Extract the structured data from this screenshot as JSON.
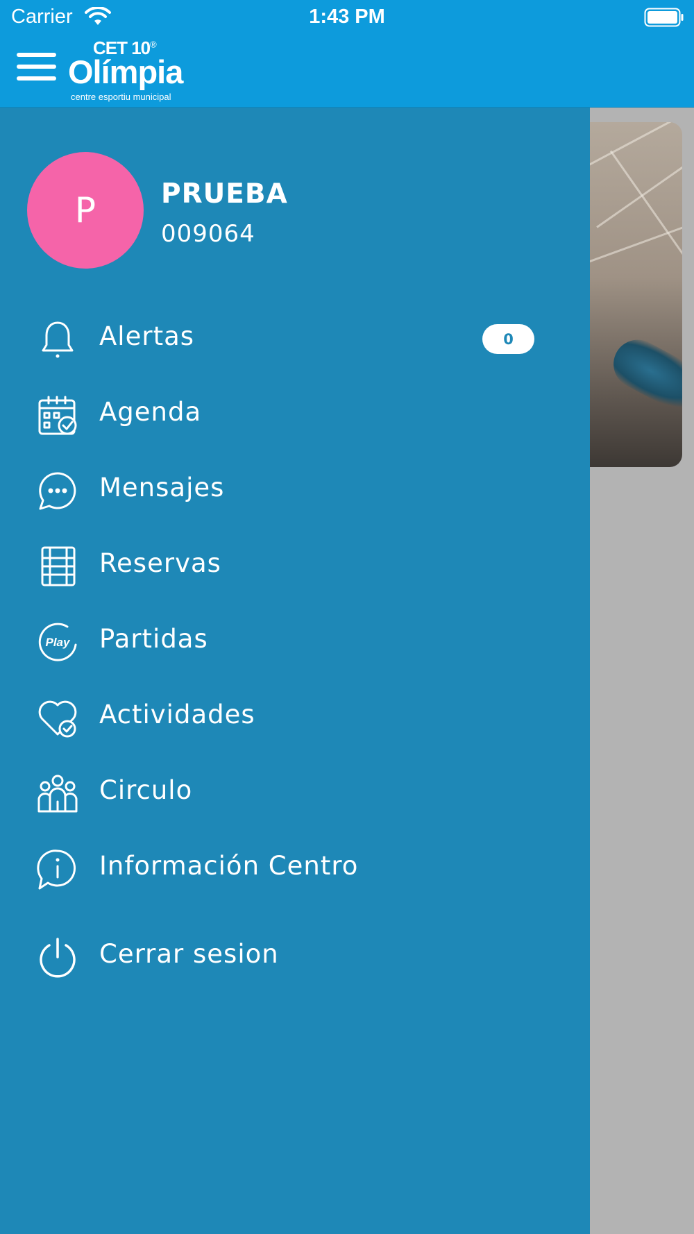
{
  "status_bar": {
    "carrier": "Carrier",
    "time": "1:43 PM"
  },
  "header": {
    "logo_top": "CET 10",
    "logo_registered": "®",
    "logo_name": "Olímpia",
    "logo_tagline": "centre esportiu municipal"
  },
  "profile": {
    "avatar_initial": "P",
    "name": "PRUEBA",
    "id": "009064"
  },
  "menu": {
    "alertas": {
      "label": "Alertas",
      "badge": "0",
      "icon": "bell-icon"
    },
    "agenda": {
      "label": "Agenda",
      "icon": "calendar-check-icon"
    },
    "mensajes": {
      "label": "Mensajes",
      "icon": "chat-bubble-icon"
    },
    "reservas": {
      "label": "Reservas",
      "icon": "court-icon"
    },
    "partidas": {
      "label": "Partidas",
      "icon": "play-icon"
    },
    "actividades": {
      "label": "Actividades",
      "icon": "heart-check-icon"
    },
    "circulo": {
      "label": "Circulo",
      "icon": "group-icon"
    },
    "informacion": {
      "label": "Información Centro",
      "icon": "info-bubble-icon"
    },
    "cerrar": {
      "label": "Cerrar sesion",
      "icon": "power-icon"
    }
  },
  "colors": {
    "header": "#0d9bdc",
    "drawer": "#1e88b7",
    "avatar": "#f564a9",
    "backdrop": "#b3b3b3"
  }
}
